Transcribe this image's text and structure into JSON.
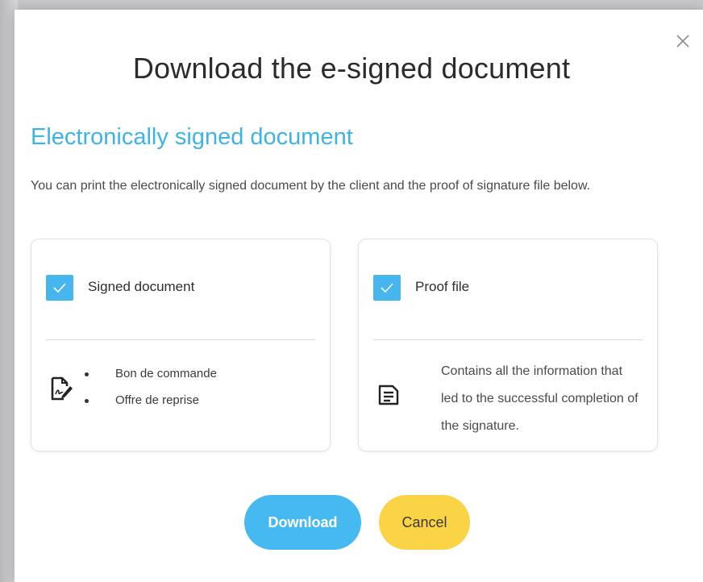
{
  "dialog": {
    "title": "Download the e-signed document",
    "subtitle": "Electronically signed document",
    "description": "You can print the electronically signed document by the client and the proof of signature file below.",
    "close_icon": "close-icon"
  },
  "cards": {
    "signed": {
      "label": "Signed document",
      "checked": true,
      "icon": "signed-document-icon",
      "items": [
        "Bon de commande",
        "Offre de reprise"
      ]
    },
    "proof": {
      "label": "Proof file",
      "checked": true,
      "icon": "file-text-icon",
      "description": "Contains all the information that led to the successful completion of the signature."
    }
  },
  "buttons": {
    "download": "Download",
    "cancel": "Cancel"
  },
  "colors": {
    "accent": "#47b6ee",
    "subtitle": "#3fb3e6",
    "cancel": "#fad445"
  }
}
